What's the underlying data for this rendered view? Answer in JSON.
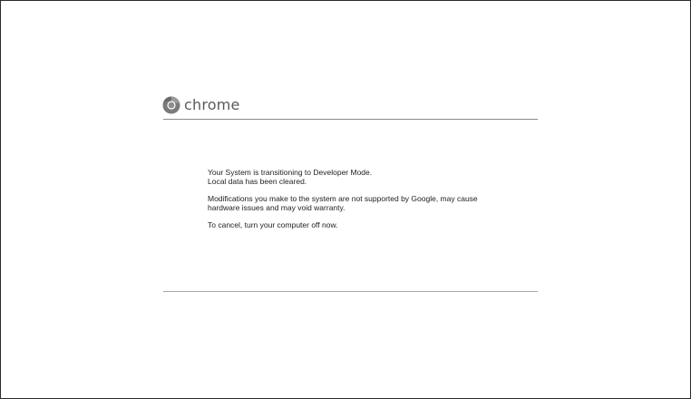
{
  "brand": {
    "logo_text": "chrome",
    "icon": "chrome-logo-icon"
  },
  "message": {
    "para1": {
      "line1": "Your System is transitioning to Developer Mode.",
      "line2": "Local data has been cleared."
    },
    "para2": {
      "line1": "Modifications you make to the system are not supported by Google, may cause",
      "line2": "hardware issues and may void warranty."
    },
    "para3": "To cancel, turn your computer off now."
  },
  "colors": {
    "background": "#ffffff",
    "text": "#222222",
    "rule": "#8a8a8a",
    "logo_gray": "#5a5a5a"
  }
}
